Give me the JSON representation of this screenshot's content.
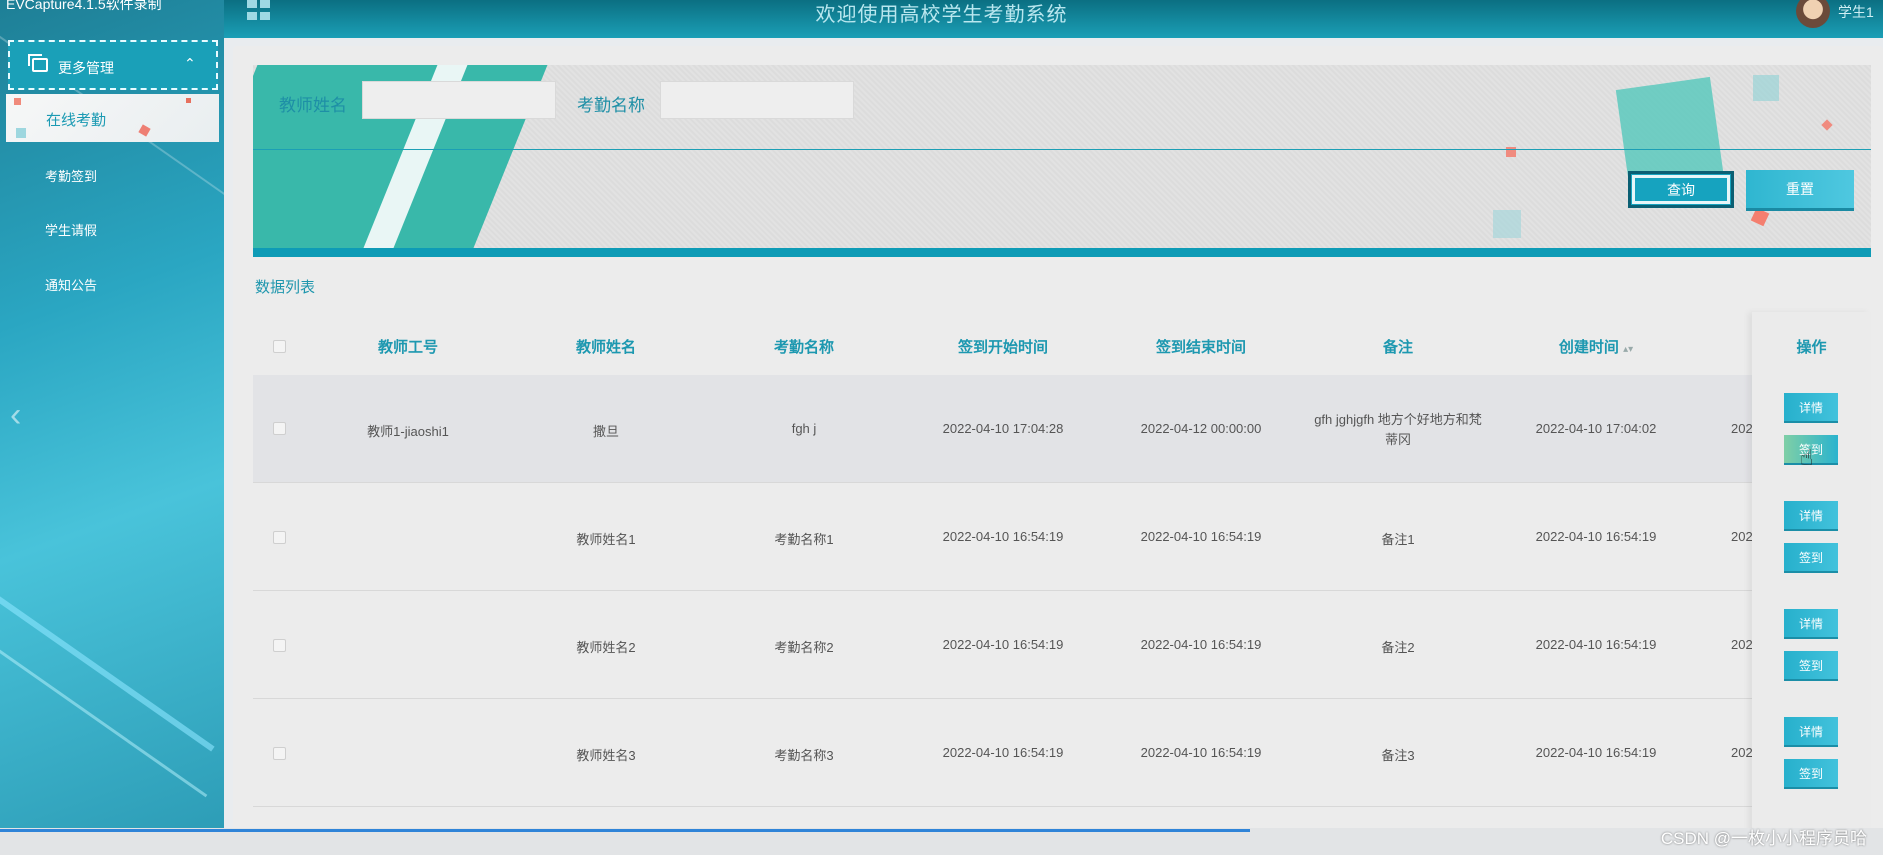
{
  "window": {
    "overlay_title": "EVCapture4.1.5软件录制"
  },
  "header": {
    "system_title": "欢迎使用高校学生考勤系统",
    "user_name": "学生1"
  },
  "sidebar": {
    "group_label": "更多管理",
    "items": [
      {
        "label": "在线考勤",
        "active": true
      },
      {
        "label": "考勤签到"
      },
      {
        "label": "学生请假"
      },
      {
        "label": "通知公告"
      }
    ]
  },
  "search": {
    "teacher_name_label": "教师姓名",
    "teacher_name_value": "",
    "attendance_name_label": "考勤名称",
    "attendance_name_value": "",
    "query_button": "查询",
    "reset_button": "重置"
  },
  "list": {
    "title": "数据列表",
    "columns": [
      "教师工号",
      "教师姓名",
      "考勤名称",
      "签到开始时间",
      "签到结束时间",
      "备注",
      "创建时间",
      "操作"
    ],
    "sort_icon": "sort-icon",
    "rows": [
      {
        "teacher_no": "教师1-jiaoshi1",
        "teacher_name": "撒旦",
        "attendance_name": "fgh j",
        "start": "2022-04-10 17:04:28",
        "end": "2022-04-12 00:00:00",
        "remark": "gfh jghjgfh 地方个好地方和梵蒂冈",
        "created": "2022-04-10 17:04:02",
        "extra": "202"
      },
      {
        "teacher_no": "",
        "teacher_name": "教师姓名1",
        "attendance_name": "考勤名称1",
        "start": "2022-04-10 16:54:19",
        "end": "2022-04-10 16:54:19",
        "remark": "备注1",
        "created": "2022-04-10 16:54:19",
        "extra": "202"
      },
      {
        "teacher_no": "",
        "teacher_name": "教师姓名2",
        "attendance_name": "考勤名称2",
        "start": "2022-04-10 16:54:19",
        "end": "2022-04-10 16:54:19",
        "remark": "备注2",
        "created": "2022-04-10 16:54:19",
        "extra": "202"
      },
      {
        "teacher_no": "",
        "teacher_name": "教师姓名3",
        "attendance_name": "考勤名称3",
        "start": "2022-04-10 16:54:19",
        "end": "2022-04-10 16:54:19",
        "remark": "备注3",
        "created": "2022-04-10 16:54:19",
        "extra": "202"
      }
    ],
    "detail_button": "详情",
    "signin_button": "签到"
  },
  "footer": {
    "watermark": "CSDN @一枚小小程序员哈"
  },
  "colors": {
    "accent": "#1d98b0",
    "sidebar": "#2aa6c2",
    "button": "#27b0cc"
  }
}
